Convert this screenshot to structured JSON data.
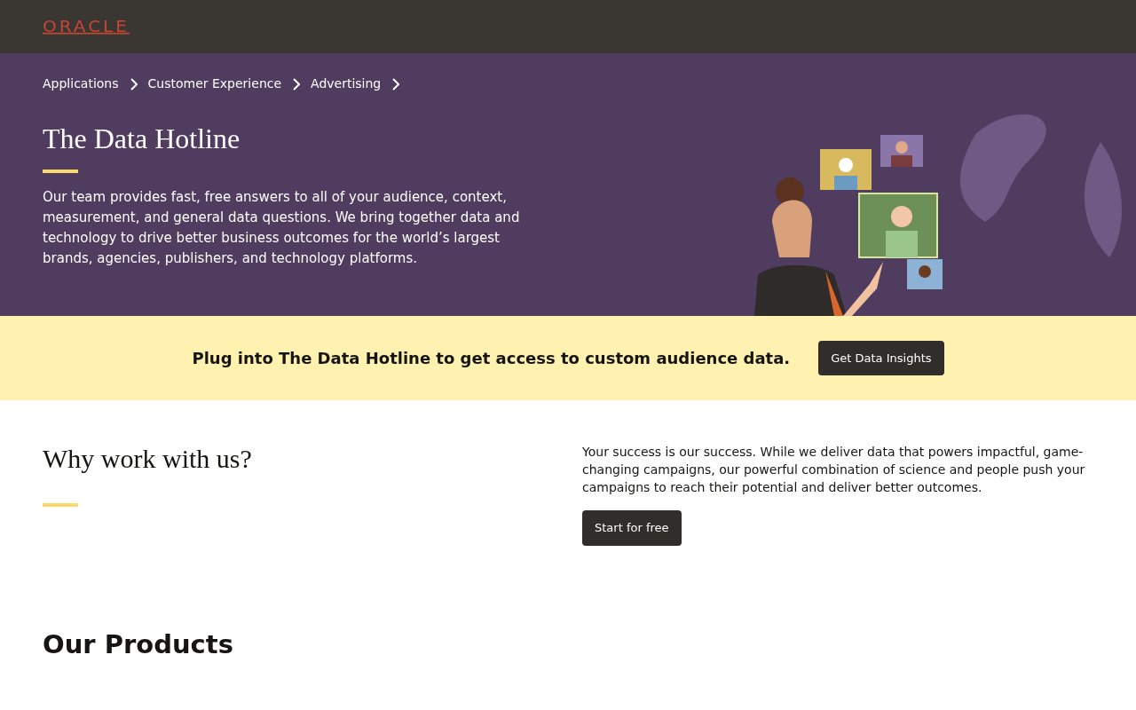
{
  "header": {
    "logo": "ORACLE"
  },
  "breadcrumbs": [
    {
      "label": "Applications"
    },
    {
      "label": "Customer Experience"
    },
    {
      "label": "Advertising"
    }
  ],
  "hero": {
    "title": "The Data Hotline",
    "text": "Our team provides fast, free answers to all of your audience, context, measurement, and general data questions. We bring together data and technology to drive better business outcomes for the world’s largest brands, agencies, publishers, and technology platforms."
  },
  "banner": {
    "text": "Plug into The Data Hotline to get access to custom audience data.",
    "button": "Get Data Insights"
  },
  "why": {
    "title": "Why work with us?",
    "text": "Your success is our success. While we deliver data that powers impactful, game-changing campaigns, our powerful combination of science and people push your campaigns to reach their potential and deliver better outcomes.",
    "button": "Start for free"
  },
  "products": {
    "title": "Our Products"
  }
}
